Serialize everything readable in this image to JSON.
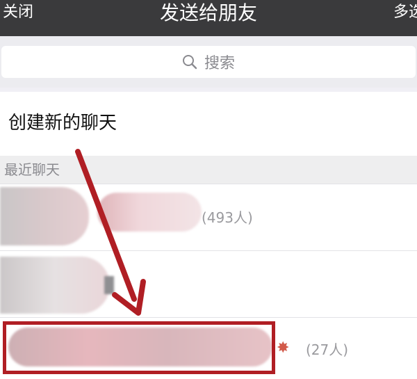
{
  "nav": {
    "close_label": "关闭",
    "title": "发送给朋友",
    "multi_label": "多选"
  },
  "search": {
    "placeholder": "搜索",
    "icon": "search-icon"
  },
  "create_chat": {
    "label": "创建新的聊天"
  },
  "recent": {
    "header": "最近聊天",
    "items": [
      {
        "count_label": "(493人)"
      },
      {
        "count_label": ""
      },
      {
        "count_label": "(27人)"
      }
    ]
  },
  "colors": {
    "nav_bg": "#3a3a3c",
    "annotation_red": "#b01e24",
    "page_bg": "#f0eff5"
  }
}
